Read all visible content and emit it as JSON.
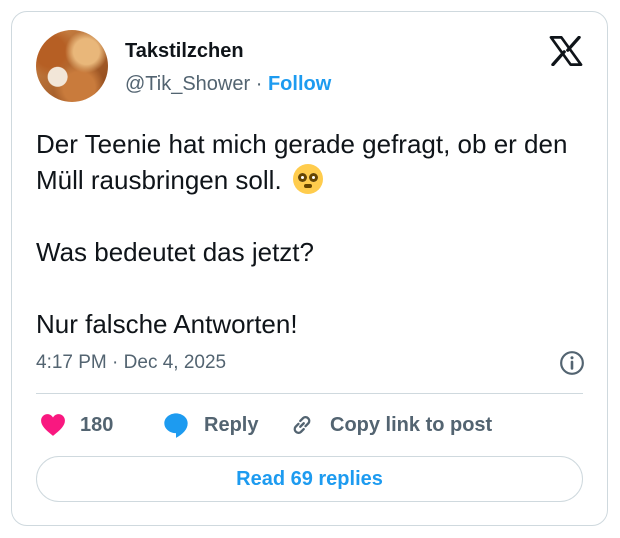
{
  "author": {
    "display_name": "Takstilzchen",
    "handle": "@Tik_Shower",
    "separator": "·",
    "follow_label": "Follow"
  },
  "post": {
    "line1": "Der Teenie hat mich gerade gefragt, ob er den Müll rausbringen soll.",
    "emoji": "flushed-face-emoji",
    "line2": "Was bedeutet das jetzt?",
    "line3": "Nur falsche Antworten!",
    "time": "4:17 PM",
    "date": "Dec 4, 2025"
  },
  "actions": {
    "like_count": "180",
    "reply_label": "Reply",
    "copy_label": "Copy link to post"
  },
  "footer": {
    "read_replies_label": "Read 69 replies"
  },
  "colors": {
    "accent": "#1d9bf0",
    "like": "#f91880",
    "secondary_text": "#536471",
    "border": "#cfd9de"
  },
  "icons": [
    "x-logo-icon",
    "info-icon",
    "heart-icon",
    "reply-bubble-icon",
    "link-icon"
  ]
}
